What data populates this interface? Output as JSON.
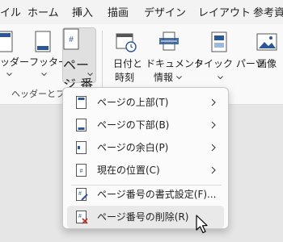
{
  "tabs": [
    "イル",
    "ホーム",
    "挿入",
    "描画",
    "デザイン",
    "レイアウト",
    "参考資"
  ],
  "ribbon": {
    "header": {
      "label": "ッダー",
      "chevron": "⌄"
    },
    "footer": {
      "label": "フッター",
      "chevron": "⌄"
    },
    "page_number": {
      "line1": "ページ",
      "line2": "番号"
    },
    "datetime": {
      "line1": "日付と",
      "line2": "時刻"
    },
    "docinfo": {
      "line1": "ドキュメント",
      "line2": "情報"
    },
    "quickparts": {
      "label": "クイック パーツ",
      "chevron": "⌄"
    },
    "image": {
      "label": "画像"
    },
    "group_label": "ヘッダーとフッ"
  },
  "menu": {
    "items": [
      {
        "label": "ページの上部(T)",
        "icon": "page-top-icon",
        "submenu": true
      },
      {
        "label": "ページの下部(B)",
        "icon": "page-bottom-icon",
        "submenu": true
      },
      {
        "label": "ページの余白(P)",
        "icon": "page-margin-icon",
        "submenu": true
      },
      {
        "label": "現在の位置(C)",
        "icon": "current-position-icon",
        "submenu": true
      },
      {
        "label": "ページ番号の書式設定(F)...",
        "icon": "format-page-number-icon",
        "submenu": false
      },
      {
        "label": "ページ番号の削除(R)",
        "icon": "remove-page-number-icon",
        "submenu": false
      }
    ]
  },
  "colors": {
    "accent": "#2b5797",
    "remove": "#c42b1c",
    "hover": "#e9e9e9"
  }
}
